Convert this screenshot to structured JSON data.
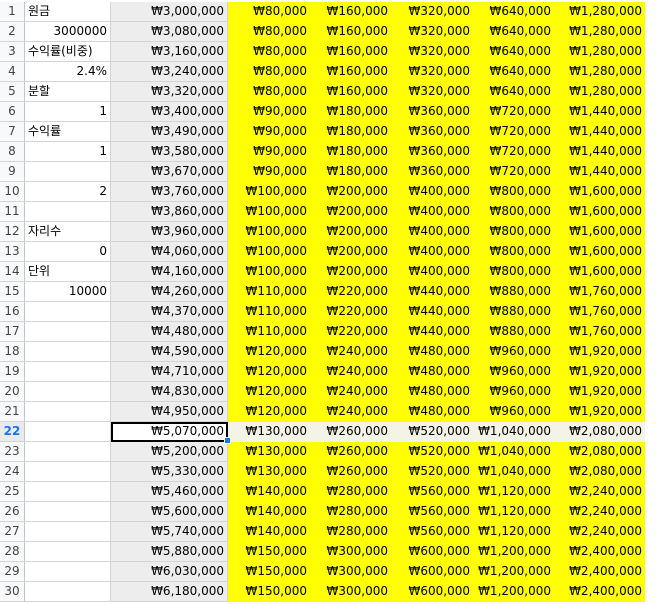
{
  "sheet": {
    "rows": [
      {
        "n": "1",
        "a": "원금",
        "a_type": "txt",
        "b": "₩3,000,000",
        "c": [
          "₩80,000",
          "₩160,000",
          "₩320,000",
          "₩640,000",
          "₩1,280,000"
        ]
      },
      {
        "n": "2",
        "a": "3000000",
        "a_type": "num",
        "b": "₩3,080,000",
        "c": [
          "₩80,000",
          "₩160,000",
          "₩320,000",
          "₩640,000",
          "₩1,280,000"
        ]
      },
      {
        "n": "3",
        "a": "수익률(비중)",
        "a_type": "txt",
        "b": "₩3,160,000",
        "c": [
          "₩80,000",
          "₩160,000",
          "₩320,000",
          "₩640,000",
          "₩1,280,000"
        ]
      },
      {
        "n": "4",
        "a": "2.4%",
        "a_type": "num",
        "b": "₩3,240,000",
        "c": [
          "₩80,000",
          "₩160,000",
          "₩320,000",
          "₩640,000",
          "₩1,280,000"
        ]
      },
      {
        "n": "5",
        "a": "분할",
        "a_type": "txt",
        "b": "₩3,320,000",
        "c": [
          "₩80,000",
          "₩160,000",
          "₩320,000",
          "₩640,000",
          "₩1,280,000"
        ]
      },
      {
        "n": "6",
        "a": "1",
        "a_type": "num",
        "b": "₩3,400,000",
        "c": [
          "₩90,000",
          "₩180,000",
          "₩360,000",
          "₩720,000",
          "₩1,440,000"
        ]
      },
      {
        "n": "7",
        "a": "수익률",
        "a_type": "txt",
        "b": "₩3,490,000",
        "c": [
          "₩90,000",
          "₩180,000",
          "₩360,000",
          "₩720,000",
          "₩1,440,000"
        ]
      },
      {
        "n": "8",
        "a": "1",
        "a_type": "num",
        "b": "₩3,580,000",
        "c": [
          "₩90,000",
          "₩180,000",
          "₩360,000",
          "₩720,000",
          "₩1,440,000"
        ]
      },
      {
        "n": "9",
        "a": "",
        "a_type": "txt",
        "b": "₩3,670,000",
        "c": [
          "₩90,000",
          "₩180,000",
          "₩360,000",
          "₩720,000",
          "₩1,440,000"
        ]
      },
      {
        "n": "10",
        "a": "2",
        "a_type": "num",
        "b": "₩3,760,000",
        "c": [
          "₩100,000",
          "₩200,000",
          "₩400,000",
          "₩800,000",
          "₩1,600,000"
        ]
      },
      {
        "n": "11",
        "a": "",
        "a_type": "txt",
        "b": "₩3,860,000",
        "c": [
          "₩100,000",
          "₩200,000",
          "₩400,000",
          "₩800,000",
          "₩1,600,000"
        ]
      },
      {
        "n": "12",
        "a": "자리수",
        "a_type": "txt",
        "b": "₩3,960,000",
        "c": [
          "₩100,000",
          "₩200,000",
          "₩400,000",
          "₩800,000",
          "₩1,600,000"
        ]
      },
      {
        "n": "13",
        "a": "0",
        "a_type": "num",
        "b": "₩4,060,000",
        "c": [
          "₩100,000",
          "₩200,000",
          "₩400,000",
          "₩800,000",
          "₩1,600,000"
        ]
      },
      {
        "n": "14",
        "a": "단위",
        "a_type": "txt",
        "b": "₩4,160,000",
        "c": [
          "₩100,000",
          "₩200,000",
          "₩400,000",
          "₩800,000",
          "₩1,600,000"
        ]
      },
      {
        "n": "15",
        "a": "10000",
        "a_type": "num",
        "b": "₩4,260,000",
        "c": [
          "₩110,000",
          "₩220,000",
          "₩440,000",
          "₩880,000",
          "₩1,760,000"
        ]
      },
      {
        "n": "16",
        "a": "",
        "a_type": "txt",
        "b": "₩4,370,000",
        "c": [
          "₩110,000",
          "₩220,000",
          "₩440,000",
          "₩880,000",
          "₩1,760,000"
        ]
      },
      {
        "n": "17",
        "a": "",
        "a_type": "txt",
        "b": "₩4,480,000",
        "c": [
          "₩110,000",
          "₩220,000",
          "₩440,000",
          "₩880,000",
          "₩1,760,000"
        ]
      },
      {
        "n": "18",
        "a": "",
        "a_type": "txt",
        "b": "₩4,590,000",
        "c": [
          "₩120,000",
          "₩240,000",
          "₩480,000",
          "₩960,000",
          "₩1,920,000"
        ]
      },
      {
        "n": "19",
        "a": "",
        "a_type": "txt",
        "b": "₩4,710,000",
        "c": [
          "₩120,000",
          "₩240,000",
          "₩480,000",
          "₩960,000",
          "₩1,920,000"
        ]
      },
      {
        "n": "20",
        "a": "",
        "a_type": "txt",
        "b": "₩4,830,000",
        "c": [
          "₩120,000",
          "₩240,000",
          "₩480,000",
          "₩960,000",
          "₩1,920,000"
        ]
      },
      {
        "n": "21",
        "a": "",
        "a_type": "txt",
        "b": "₩4,950,000",
        "c": [
          "₩120,000",
          "₩240,000",
          "₩480,000",
          "₩960,000",
          "₩1,920,000"
        ]
      },
      {
        "n": "22",
        "a": "",
        "a_type": "txt",
        "b": "₩5,070,000",
        "c": [
          "₩130,000",
          "₩260,000",
          "₩520,000",
          "₩1,040,000",
          "₩2,080,000"
        ],
        "active": true
      },
      {
        "n": "23",
        "a": "",
        "a_type": "txt",
        "b": "₩5,200,000",
        "c": [
          "₩130,000",
          "₩260,000",
          "₩520,000",
          "₩1,040,000",
          "₩2,080,000"
        ]
      },
      {
        "n": "24",
        "a": "",
        "a_type": "txt",
        "b": "₩5,330,000",
        "c": [
          "₩130,000",
          "₩260,000",
          "₩520,000",
          "₩1,040,000",
          "₩2,080,000"
        ]
      },
      {
        "n": "25",
        "a": "",
        "a_type": "txt",
        "b": "₩5,460,000",
        "c": [
          "₩140,000",
          "₩280,000",
          "₩560,000",
          "₩1,120,000",
          "₩2,240,000"
        ]
      },
      {
        "n": "26",
        "a": "",
        "a_type": "txt",
        "b": "₩5,600,000",
        "c": [
          "₩140,000",
          "₩280,000",
          "₩560,000",
          "₩1,120,000",
          "₩2,240,000"
        ]
      },
      {
        "n": "27",
        "a": "",
        "a_type": "txt",
        "b": "₩5,740,000",
        "c": [
          "₩140,000",
          "₩280,000",
          "₩560,000",
          "₩1,120,000",
          "₩2,240,000"
        ]
      },
      {
        "n": "28",
        "a": "",
        "a_type": "txt",
        "b": "₩5,880,000",
        "c": [
          "₩150,000",
          "₩300,000",
          "₩600,000",
          "₩1,200,000",
          "₩2,400,000"
        ]
      },
      {
        "n": "29",
        "a": "",
        "a_type": "txt",
        "b": "₩6,030,000",
        "c": [
          "₩150,000",
          "₩300,000",
          "₩600,000",
          "₩1,200,000",
          "₩2,400,000"
        ]
      },
      {
        "n": "30",
        "a": "",
        "a_type": "txt",
        "b": "₩6,180,000",
        "c": [
          "₩150,000",
          "₩300,000",
          "₩600,000",
          "₩1,200,000",
          "₩2,400,000"
        ]
      }
    ],
    "colors": {
      "highlight": "#ffff00",
      "active_row_header": "#1a73e8",
      "selection_border": "#000000"
    }
  }
}
